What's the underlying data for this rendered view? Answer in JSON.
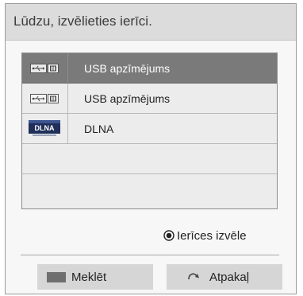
{
  "dialog": {
    "title": "Lūdzu, izvēlieties ierīci."
  },
  "devices": [
    {
      "icon": "usb-icon",
      "label": "USB apzīmējums",
      "selected": true
    },
    {
      "icon": "usb-icon",
      "label": "USB apzīmējums",
      "selected": false
    },
    {
      "icon": "dlna-icon",
      "icon_text": "DLNA",
      "label": "DLNA",
      "selected": false
    },
    {
      "label": ""
    },
    {
      "label": ""
    }
  ],
  "hint": {
    "label": "Ierīces izvēle"
  },
  "buttons": {
    "search_label": "Meklēt",
    "back_label": "Atpakaļ"
  },
  "colors": {
    "title_bar": "#dcdcdc",
    "selected_row": "#7a7a7a",
    "list_bg": "#ececec",
    "button_bg": "#d6d6d6"
  }
}
